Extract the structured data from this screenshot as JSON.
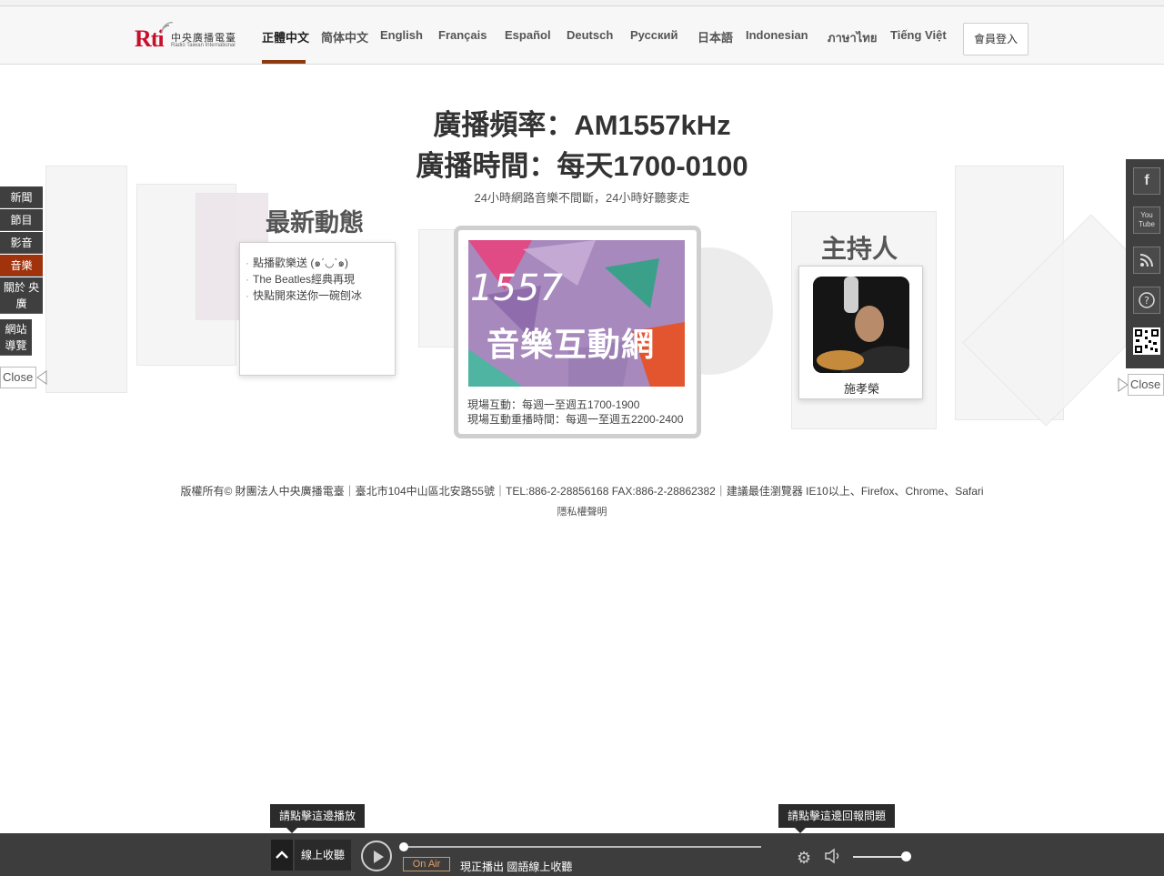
{
  "logo": {
    "brand": "Rti",
    "name_cn": "中央廣播電臺",
    "name_en": "Radio Taiwan International"
  },
  "languages": [
    "正體中文",
    "简体中文",
    "English",
    "Français",
    "Español",
    "Deutsch",
    "Русский",
    "日本語",
    "Indonesian",
    "ภาษาไทย",
    "Tiếng Việt"
  ],
  "active_language": "正體中文",
  "login_label": "會員登入",
  "hero": {
    "frequency": "廣播頻率：AM1557kHz",
    "schedule": "廣播時間：每天1700-0100",
    "tagline": "24小時網路音樂不間斷，24小時好聽麥走"
  },
  "news": {
    "title": "最新動態",
    "items": [
      "點播歡樂送 (๑ˊ◡ˋ๑)",
      "The Beatles經典再現",
      "快點開來送你一碗刨冰"
    ]
  },
  "feature": {
    "number": "1557",
    "name": "音樂互動網",
    "line1": "現場互動：每週一至週五1700-1900",
    "line2": "現場互動重播時間：每週一至週五2200-2400"
  },
  "host": {
    "title": "主持人",
    "name": "施孝榮"
  },
  "left_nav": [
    "新聞",
    "節目",
    "影音",
    "音樂",
    "關於 央廣",
    "網站 導覽"
  ],
  "left_nav_active": "音樂",
  "close_label": "Close",
  "social": [
    "facebook-icon",
    "youtube-icon",
    "rss-icon",
    "help-icon",
    "qr-code-icon"
  ],
  "footer": {
    "copyright": "版權所有© 財團法人中央廣播電臺｜臺北市104中山區北安路55號｜TEL:886-2-28856168 FAX:886-2-28862382｜建議最佳瀏覽器 IE10以上、Firefox、Chrome、Safari",
    "privacy": "隱私權聲明"
  },
  "tooltips": {
    "play": "請點擊這邊播放",
    "report": "請點擊這邊回報問題"
  },
  "player": {
    "listen_label": "線上收聽",
    "on_air": "On Air",
    "now_playing": "現正播出 國語線上收聽",
    "volume": 1.0,
    "progress": 0.0
  },
  "colors": {
    "accent": "#a0320c",
    "nav_bg": "#3f3f3f",
    "player_bg": "#3d3d3d",
    "brand_red": "#c8102e"
  }
}
